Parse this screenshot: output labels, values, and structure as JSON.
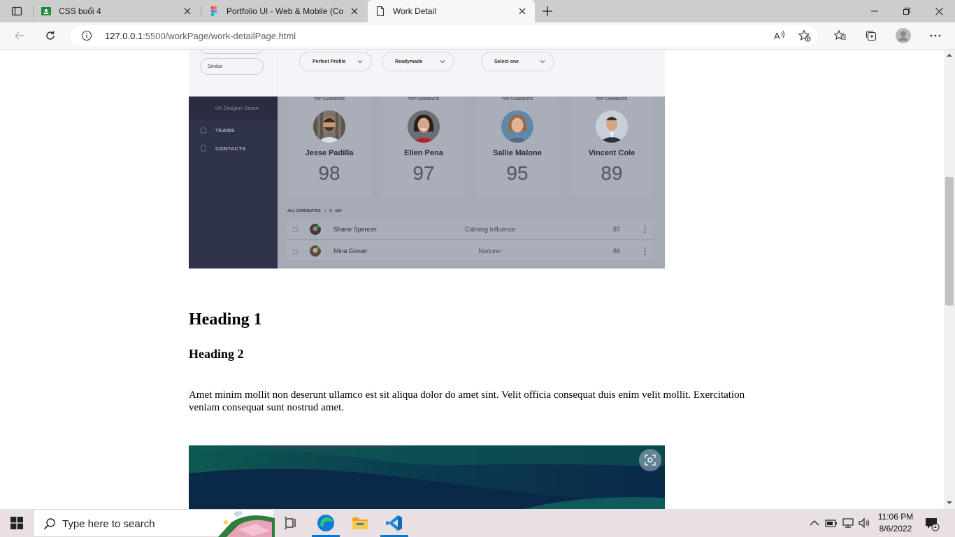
{
  "browser": {
    "tabs": [
      {
        "title": "CSS buổi 4",
        "icon": "google-classroom-icon",
        "active": false
      },
      {
        "title": "Portfolio UI - Web & Mobile (Co",
        "icon": "figma-icon",
        "active": false
      },
      {
        "title": "Work Detail",
        "icon": "page-icon",
        "active": true
      }
    ],
    "address": {
      "host": "127.0.0.1",
      "path": ":5500/workPage/work-detailPage.html"
    }
  },
  "mockup": {
    "filters": {
      "similar": "Similar",
      "perfect_profile": "Perfect Profile",
      "readymade": "Readymade",
      "select_one": "Select one"
    },
    "sidebar": {
      "subtitle": "UX Designer Senior",
      "items": [
        "TEAMS",
        "CONTACTS"
      ]
    },
    "top_candidate_label": "TOP CANDIDATE",
    "candidates": [
      {
        "name": "Jesse Padilla",
        "score": "98"
      },
      {
        "name": "Ellen Pena",
        "score": "97"
      },
      {
        "name": "Sallie Malone",
        "score": "95"
      },
      {
        "name": "Vincent Cole",
        "score": "89"
      }
    ],
    "all_candidates_label": "ALL CANDIDATES",
    "all_candidates_range": "5 - 169",
    "list": [
      {
        "name": "Shane Spencer",
        "tag": "Calming Influence",
        "score": "87"
      },
      {
        "name": "Mina Glover",
        "tag": "Nurturer",
        "score": "86"
      }
    ]
  },
  "content": {
    "heading1": "Heading 1",
    "heading2": "Heading 2",
    "paragraph": "Amet minim mollit non deserunt ullamco est sit aliqua dolor do amet sint. Velit officia consequat duis enim velit mollit. Exercitation veniam consequat sunt nostrud amet."
  },
  "taskbar": {
    "search_placeholder": "Type here to search",
    "time": "11:06 PM",
    "date": "8/6/2022",
    "notification_count": "1",
    "pinned": [
      "task-view-icon",
      "edge-icon",
      "file-explorer-icon",
      "vscode-icon"
    ]
  }
}
